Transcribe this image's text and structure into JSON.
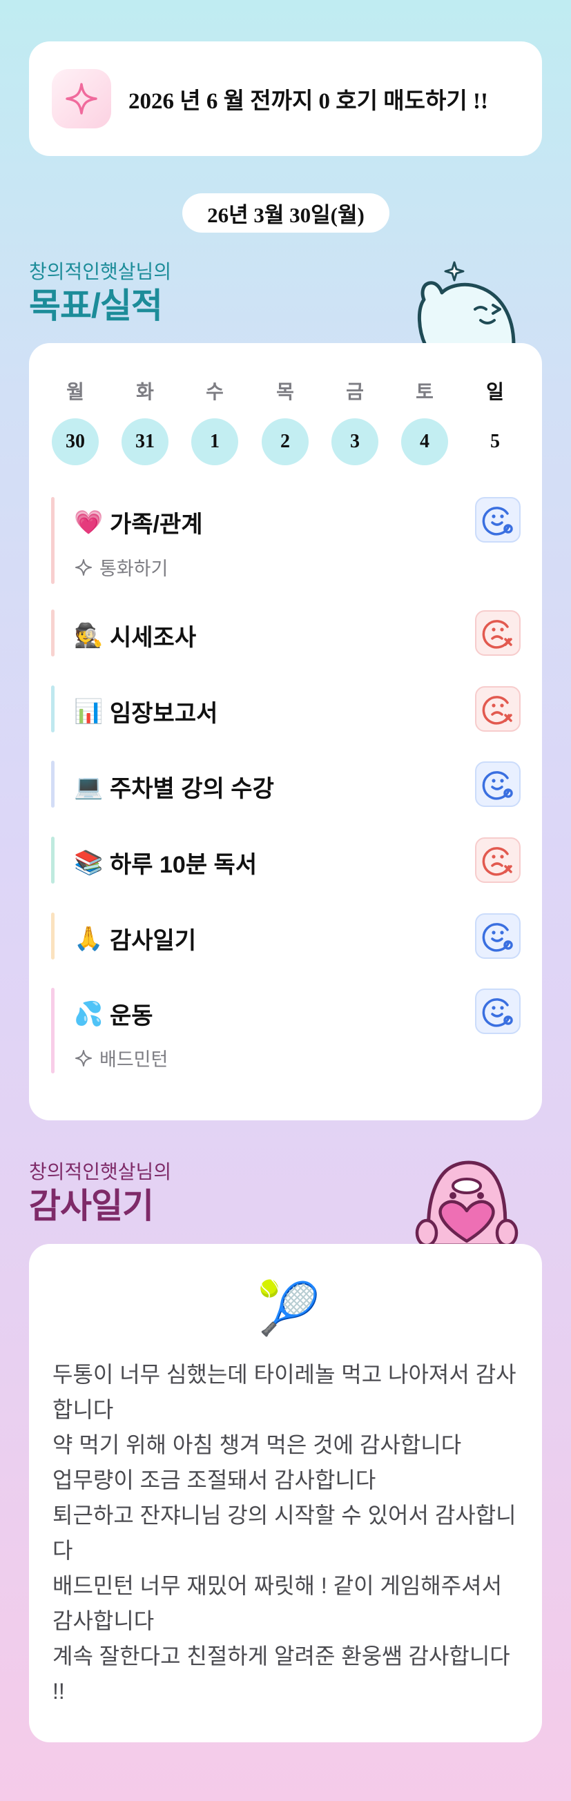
{
  "goal_banner": {
    "text": "2026 년 6 월 전까지 0 호기 매도하기 !!",
    "icon": "sparkle-icon"
  },
  "date": "26년 3월 30일(월)",
  "goals_section": {
    "subtitle": "창의적인햇살님의",
    "title": "목표/실적"
  },
  "week": {
    "days": [
      {
        "dow": "월",
        "date": "30",
        "has_record": true
      },
      {
        "dow": "화",
        "date": "31",
        "has_record": true
      },
      {
        "dow": "수",
        "date": "1",
        "has_record": true
      },
      {
        "dow": "목",
        "date": "2",
        "has_record": true
      },
      {
        "dow": "금",
        "date": "3",
        "has_record": true
      },
      {
        "dow": "토",
        "date": "4",
        "has_record": true
      },
      {
        "dow": "일",
        "date": "5",
        "has_record": false
      }
    ]
  },
  "tasks": [
    {
      "emoji": "💗",
      "title": "가족/관계",
      "sub": "통화하기",
      "status": "done",
      "bar_color": "#f8cfcf"
    },
    {
      "emoji": "🕵️",
      "title": "시세조사",
      "status": "missed",
      "bar_color": "#f8d3d0"
    },
    {
      "emoji": "📊",
      "title": "임장보고서",
      "status": "missed",
      "bar_color": "#bfe8ef"
    },
    {
      "emoji": "💻",
      "title": "주차별 강의 수강",
      "status": "done",
      "bar_color": "#d3ddf6"
    },
    {
      "emoji": "📚",
      "title": "하루 10분 독서",
      "status": "missed",
      "bar_color": "#bfeadf"
    },
    {
      "emoji": "🙏",
      "title": "감사일기",
      "status": "done",
      "bar_color": "#fbe2bf"
    },
    {
      "emoji": "💦",
      "title": "운동",
      "sub": "배드민턴",
      "status": "done",
      "bar_color": "#f8cde8"
    }
  ],
  "gratitude_section": {
    "subtitle": "창의적인햇살님의",
    "title": "감사일기",
    "emoji": "🎾"
  },
  "gratitude_lines": [
    "두통이 너무 심했는데 타이레놀 먹고 나아져서 감사합니다",
    "약 먹기 위해 아침 챙겨 먹은 것에 감사합니다",
    "업무량이 조금 조절돼서 감사합니다",
    "퇴근하고 잔쟈니님 강의 시작할 수 있어서 감사합니다",
    "배드민턴 너무 재밌어 짜릿해 ! 같이 게임해주셔서 감사합니다",
    "계속 잘한다고 친절하게 알려준 환웅쌤 감사합니다 !!"
  ],
  "colors": {
    "accent_teal": "#1c8c99",
    "accent_plum": "#7e2a68",
    "done_blue": "#3a6fe0",
    "missed_red": "#e2594f",
    "day_circle": "#c3eef2"
  }
}
